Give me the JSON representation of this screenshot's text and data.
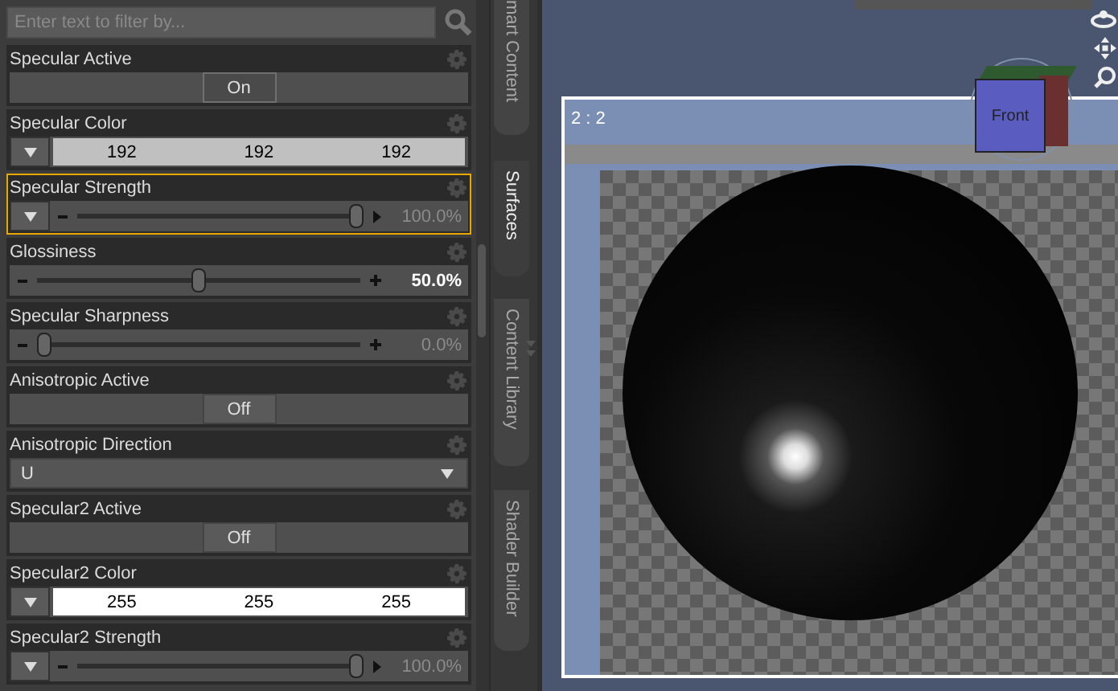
{
  "search": {
    "placeholder": "Enter text to filter by..."
  },
  "properties": [
    {
      "kind": "toggle",
      "label": "Specular Active",
      "value": "On",
      "on": true,
      "selected": false
    },
    {
      "kind": "color",
      "label": "Specular Color",
      "values": [
        "192",
        "192",
        "192"
      ],
      "color": "#c0c0c0",
      "selected": false
    },
    {
      "kind": "slider",
      "label": "Specular Strength",
      "has_menu": true,
      "level": 1,
      "reading": "100.0%",
      "modified": false,
      "capped": true,
      "selected": true
    },
    {
      "kind": "slider",
      "label": "Glossiness",
      "has_menu": false,
      "level": 0.5,
      "reading": "50.0%",
      "modified": true,
      "capped": false,
      "selected": false
    },
    {
      "kind": "slider",
      "label": "Specular Sharpness",
      "has_menu": false,
      "level": 0,
      "reading": "0.0%",
      "modified": false,
      "capped": false,
      "selected": false
    },
    {
      "kind": "toggle",
      "label": "Anisotropic Active",
      "value": "Off",
      "on": false,
      "selected": false
    },
    {
      "kind": "dropdown",
      "label": "Anisotropic Direction",
      "value": "U",
      "selected": false
    },
    {
      "kind": "toggle",
      "label": "Specular2 Active",
      "value": "Off",
      "on": false,
      "selected": false
    },
    {
      "kind": "color",
      "label": "Specular2 Color",
      "values": [
        "255",
        "255",
        "255"
      ],
      "color": "#ffffff",
      "selected": false
    },
    {
      "kind": "slider",
      "label": "Specular2 Strength",
      "has_menu": true,
      "level": 1,
      "reading": "100.0%",
      "modified": false,
      "capped": true,
      "selected": false
    }
  ],
  "side_tabs": [
    {
      "label": "mart Content",
      "selected": false
    },
    {
      "label": "Surfaces",
      "selected": true
    },
    {
      "label": "Content Library",
      "selected": false
    },
    {
      "label": "Shader Builder",
      "selected": false
    }
  ],
  "viewport": {
    "frame_label": "2 : 2",
    "cube_face": "Front"
  }
}
